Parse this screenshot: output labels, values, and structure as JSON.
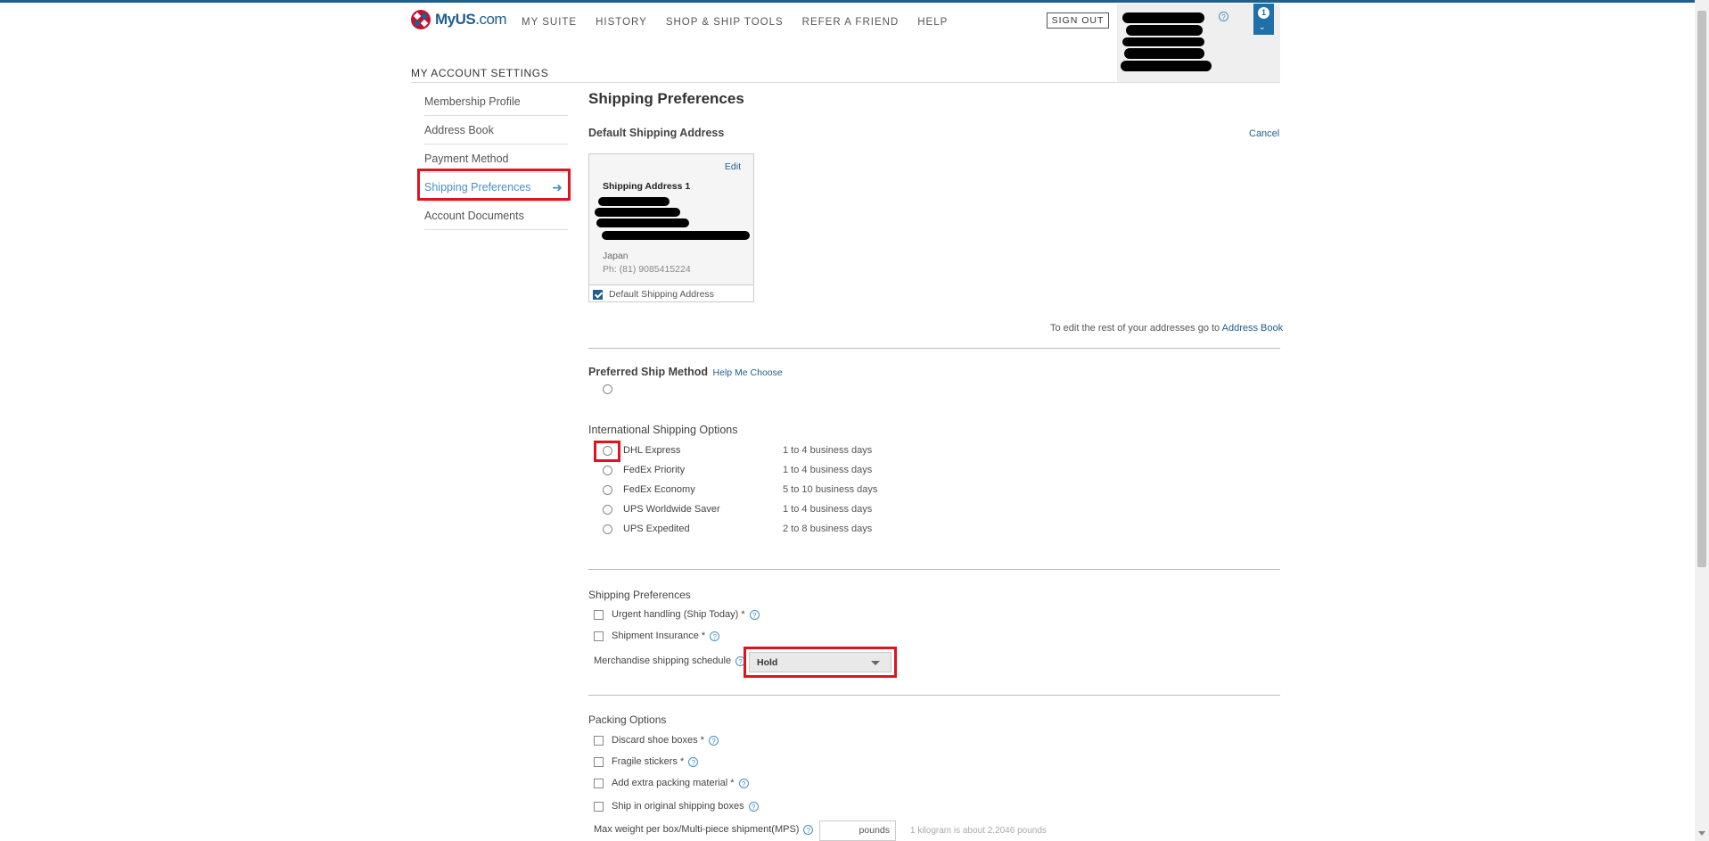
{
  "header": {
    "logo_my": "My",
    "logo_us": "US",
    "logo_com": ".com",
    "nav": [
      "MY SUITE",
      "HISTORY",
      "SHOP & SHIP TOOLS",
      "REFER A FRIEND",
      "HELP"
    ],
    "sign_out": "SIGN OUT",
    "help_glyph": "?",
    "badge_count": "1"
  },
  "page_heading": "MY ACCOUNT SETTINGS",
  "sidebar": {
    "items": [
      {
        "label": "Membership Profile"
      },
      {
        "label": "Address Book"
      },
      {
        "label": "Payment Method"
      },
      {
        "label": "Shipping Preferences"
      },
      {
        "label": "Account Documents"
      }
    ],
    "active_index": 3
  },
  "main": {
    "title": "Shipping Preferences",
    "default_address_heading": "Default Shipping Address",
    "cancel": "Cancel",
    "address_card": {
      "edit": "Edit",
      "title": "Shipping Address 1",
      "country": "Japan",
      "phone": "Ph: (81) 9085415224",
      "default_label": "Default Shipping Address"
    },
    "address_book_note": "To edit the rest of your addresses go to",
    "address_book_link": "Address Book",
    "preferred_ship_method": "Preferred Ship Method",
    "help_me_choose": "Help Me Choose",
    "international_heading": "International Shipping Options",
    "shipping_options": [
      {
        "name": "DHL Express",
        "days": "1 to 4 business days"
      },
      {
        "name": "FedEx Priority",
        "days": "1 to 4 business days"
      },
      {
        "name": "FedEx Economy",
        "days": "5 to 10 business days"
      },
      {
        "name": "UPS Worldwide Saver",
        "days": "1 to 4 business days"
      },
      {
        "name": "UPS Expedited",
        "days": "2 to 8 business days"
      }
    ],
    "shipping_prefs_heading": "Shipping Preferences",
    "urgent_handling": "Urgent handling (Ship Today) *",
    "shipment_insurance": "Shipment Insurance *",
    "merch_schedule_label": "Merchandise shipping schedule",
    "merch_schedule_value": "Hold",
    "packing_heading": "Packing Options",
    "packing_options": [
      "Discard shoe boxes *",
      "Fragile stickers *",
      "Add extra packing material *",
      "Ship in original shipping boxes"
    ],
    "max_weight_label": "Max weight per box/Multi-piece shipment(MPS)",
    "weight_unit": "pounds",
    "kg_note": "1 kilogram is about 2.2046 pounds"
  },
  "colors": {
    "accent": "#1f5f8f",
    "link_active": "#4a90c2",
    "highlight": "#e0141e"
  }
}
